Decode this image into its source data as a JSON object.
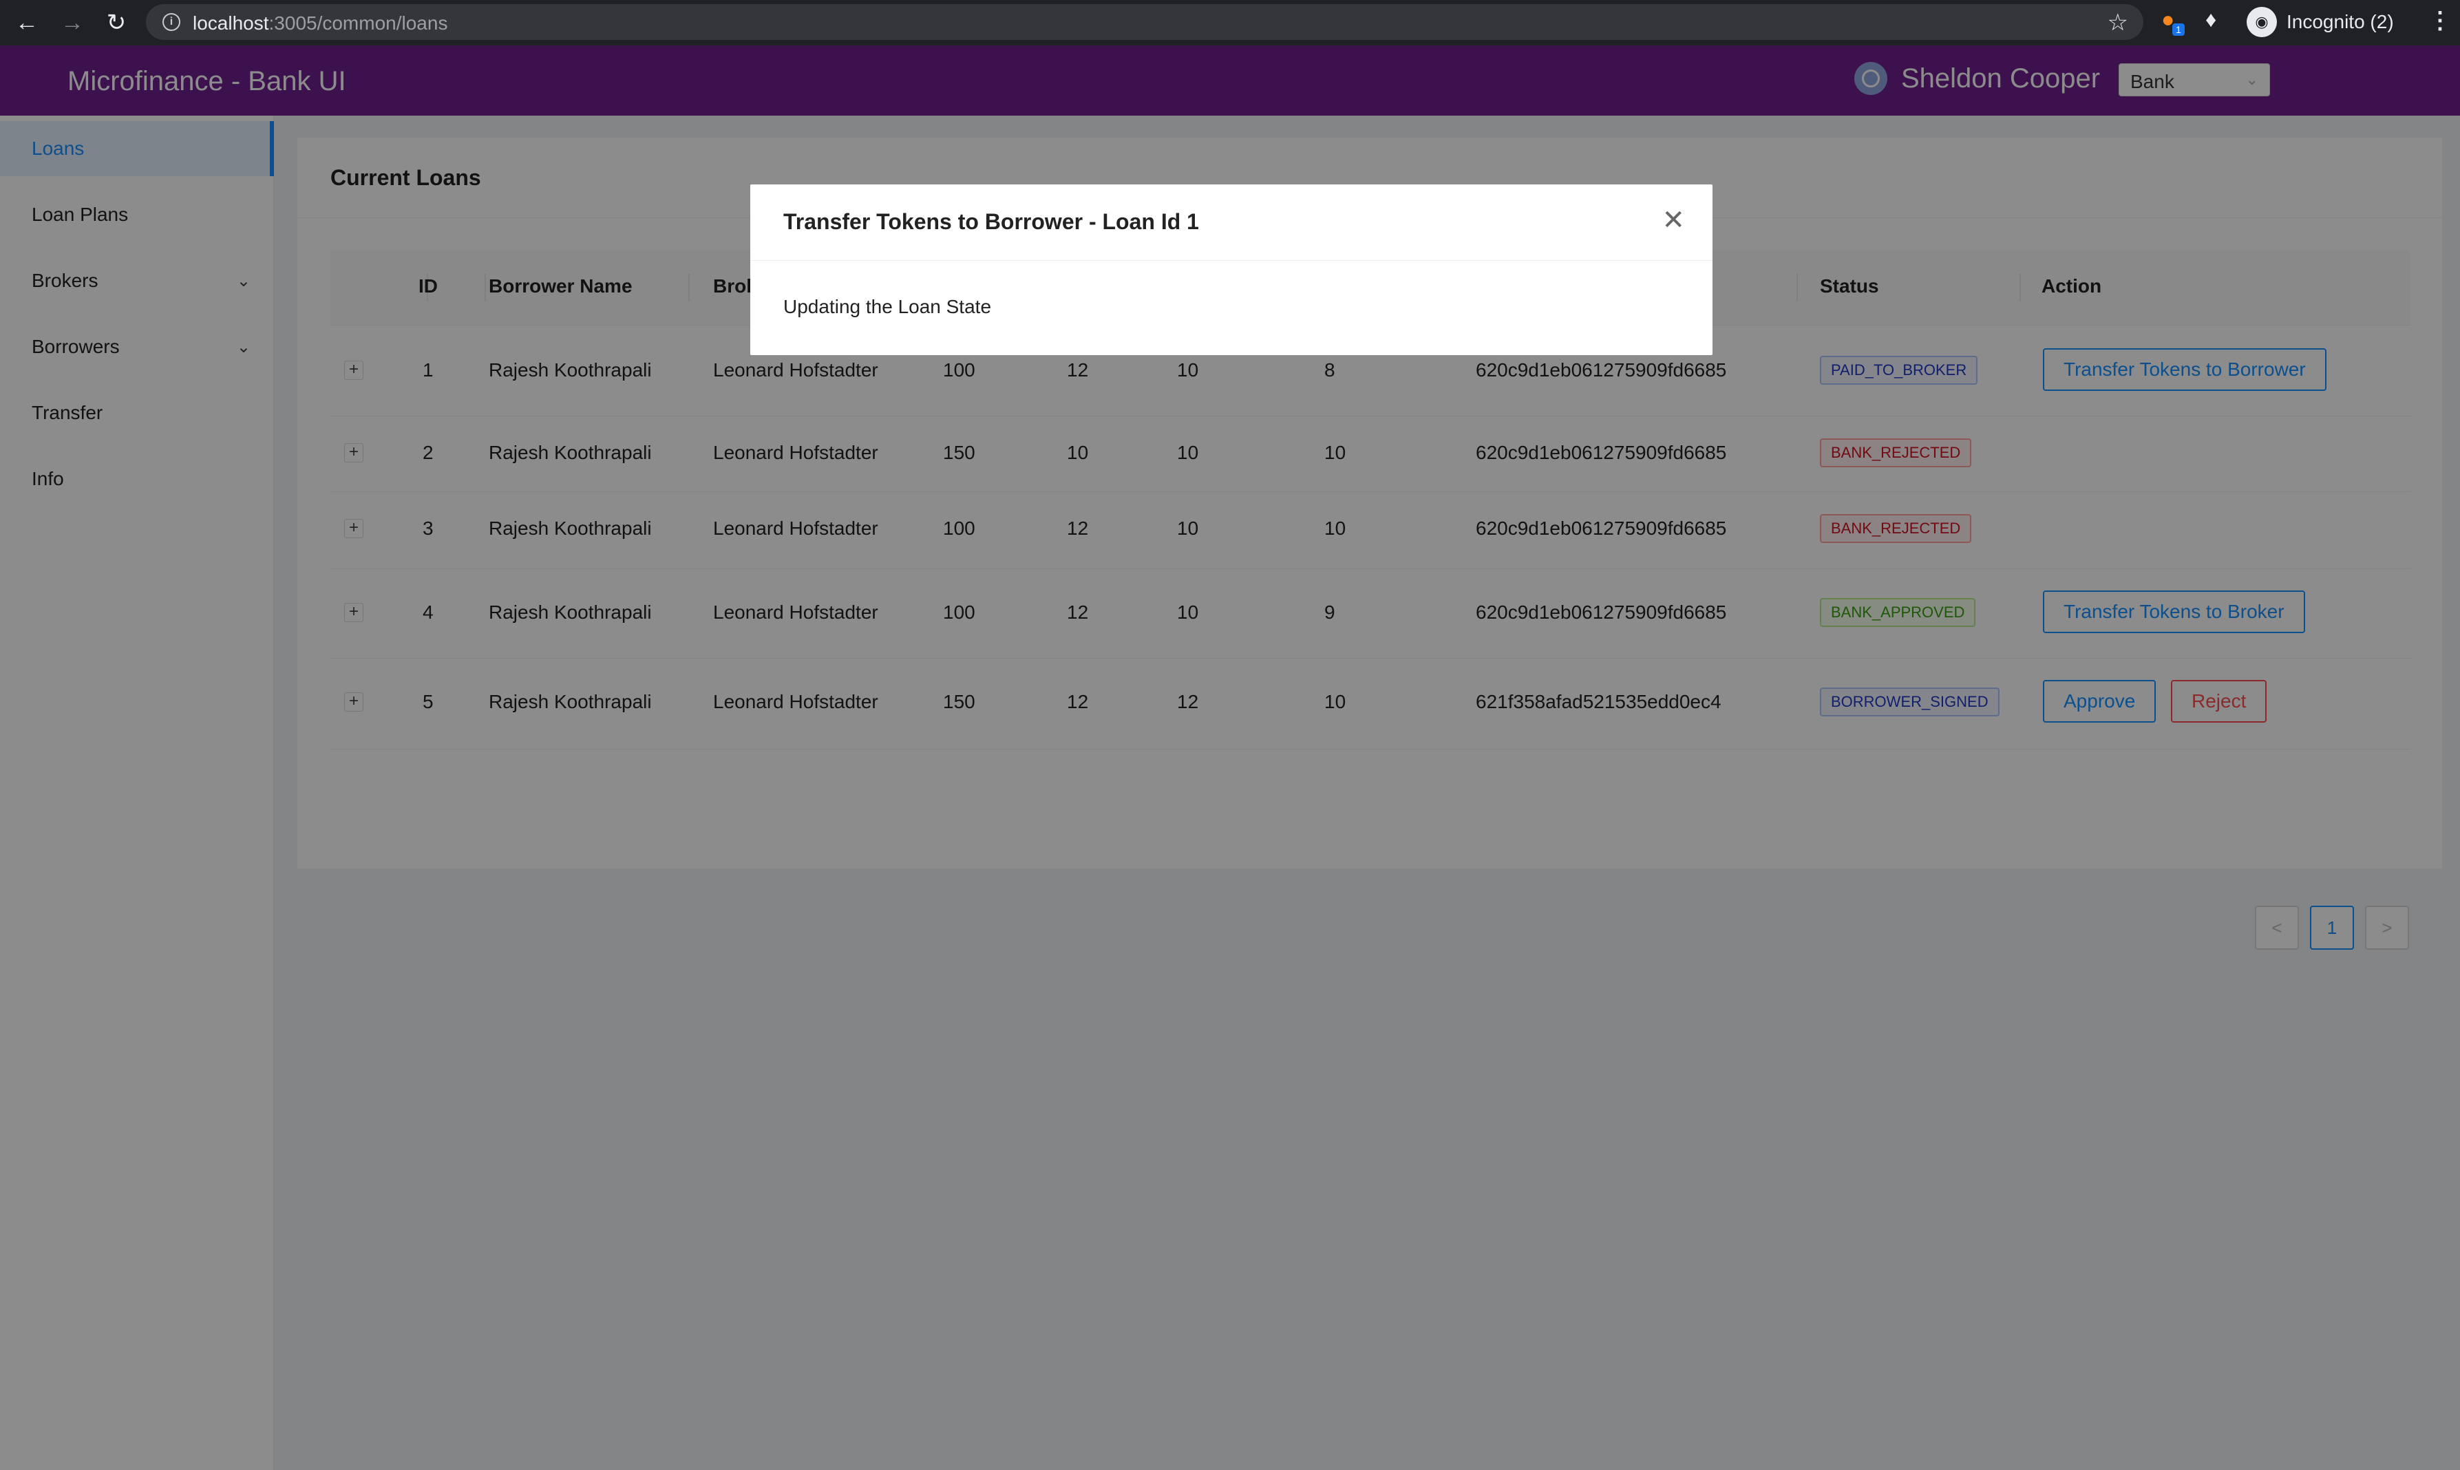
{
  "browser": {
    "url_host": "localhost",
    "url_rest": ":3005/common/loans",
    "profile_label": "Incognito (2)",
    "ext_badge": "1"
  },
  "header": {
    "title": "Microfinance - Bank UI",
    "user_name": "Sheldon Cooper",
    "role": "Bank"
  },
  "sidebar": {
    "items": [
      {
        "label": "Loans"
      },
      {
        "label": "Loan Plans"
      },
      {
        "label": "Brokers"
      },
      {
        "label": "Borrowers"
      },
      {
        "label": "Transfer"
      },
      {
        "label": "Info"
      }
    ]
  },
  "main": {
    "title": "Current Loans",
    "columns": [
      "ID",
      "Borrower Name",
      "Brok",
      "Status",
      "Action"
    ],
    "rows": [
      {
        "id": "1",
        "borrower": "Rajesh Koothrapali",
        "broker": "Leonard Hofstadter",
        "c1": "100",
        "c2": "12",
        "c3": "10",
        "c4": "8",
        "hash": "620c9d1eb061275909fd6685",
        "status": "PAID_TO_BROKER",
        "actions": [
          "Transfer Tokens to Borrower"
        ]
      },
      {
        "id": "2",
        "borrower": "Rajesh Koothrapali",
        "broker": "Leonard Hofstadter",
        "c1": "150",
        "c2": "10",
        "c3": "10",
        "c4": "10",
        "hash": "620c9d1eb061275909fd6685",
        "status": "BANK_REJECTED",
        "actions": []
      },
      {
        "id": "3",
        "borrower": "Rajesh Koothrapali",
        "broker": "Leonard Hofstadter",
        "c1": "100",
        "c2": "12",
        "c3": "10",
        "c4": "10",
        "hash": "620c9d1eb061275909fd6685",
        "status": "BANK_REJECTED",
        "actions": []
      },
      {
        "id": "4",
        "borrower": "Rajesh Koothrapali",
        "broker": "Leonard Hofstadter",
        "c1": "100",
        "c2": "12",
        "c3": "10",
        "c4": "9",
        "hash": "620c9d1eb061275909fd6685",
        "status": "BANK_APPROVED",
        "actions": [
          "Transfer Tokens to Broker"
        ]
      },
      {
        "id": "5",
        "borrower": "Rajesh Koothrapali",
        "broker": "Leonard Hofstadter",
        "c1": "150",
        "c2": "12",
        "c3": "12",
        "c4": "10",
        "hash": "621f358afad521535edd0ec4",
        "status": "BORROWER_SIGNED",
        "actions": [
          "Approve",
          "Reject"
        ]
      }
    ],
    "pagination": {
      "prev": "<",
      "current": "1",
      "next": ">"
    }
  },
  "modal": {
    "title": "Transfer Tokens to Borrower - Loan Id 1",
    "body": "Updating the Loan State"
  },
  "colors": {
    "header_bg": "#6e1f8f",
    "accent": "#1890ff",
    "danger": "#ff4d4f"
  }
}
